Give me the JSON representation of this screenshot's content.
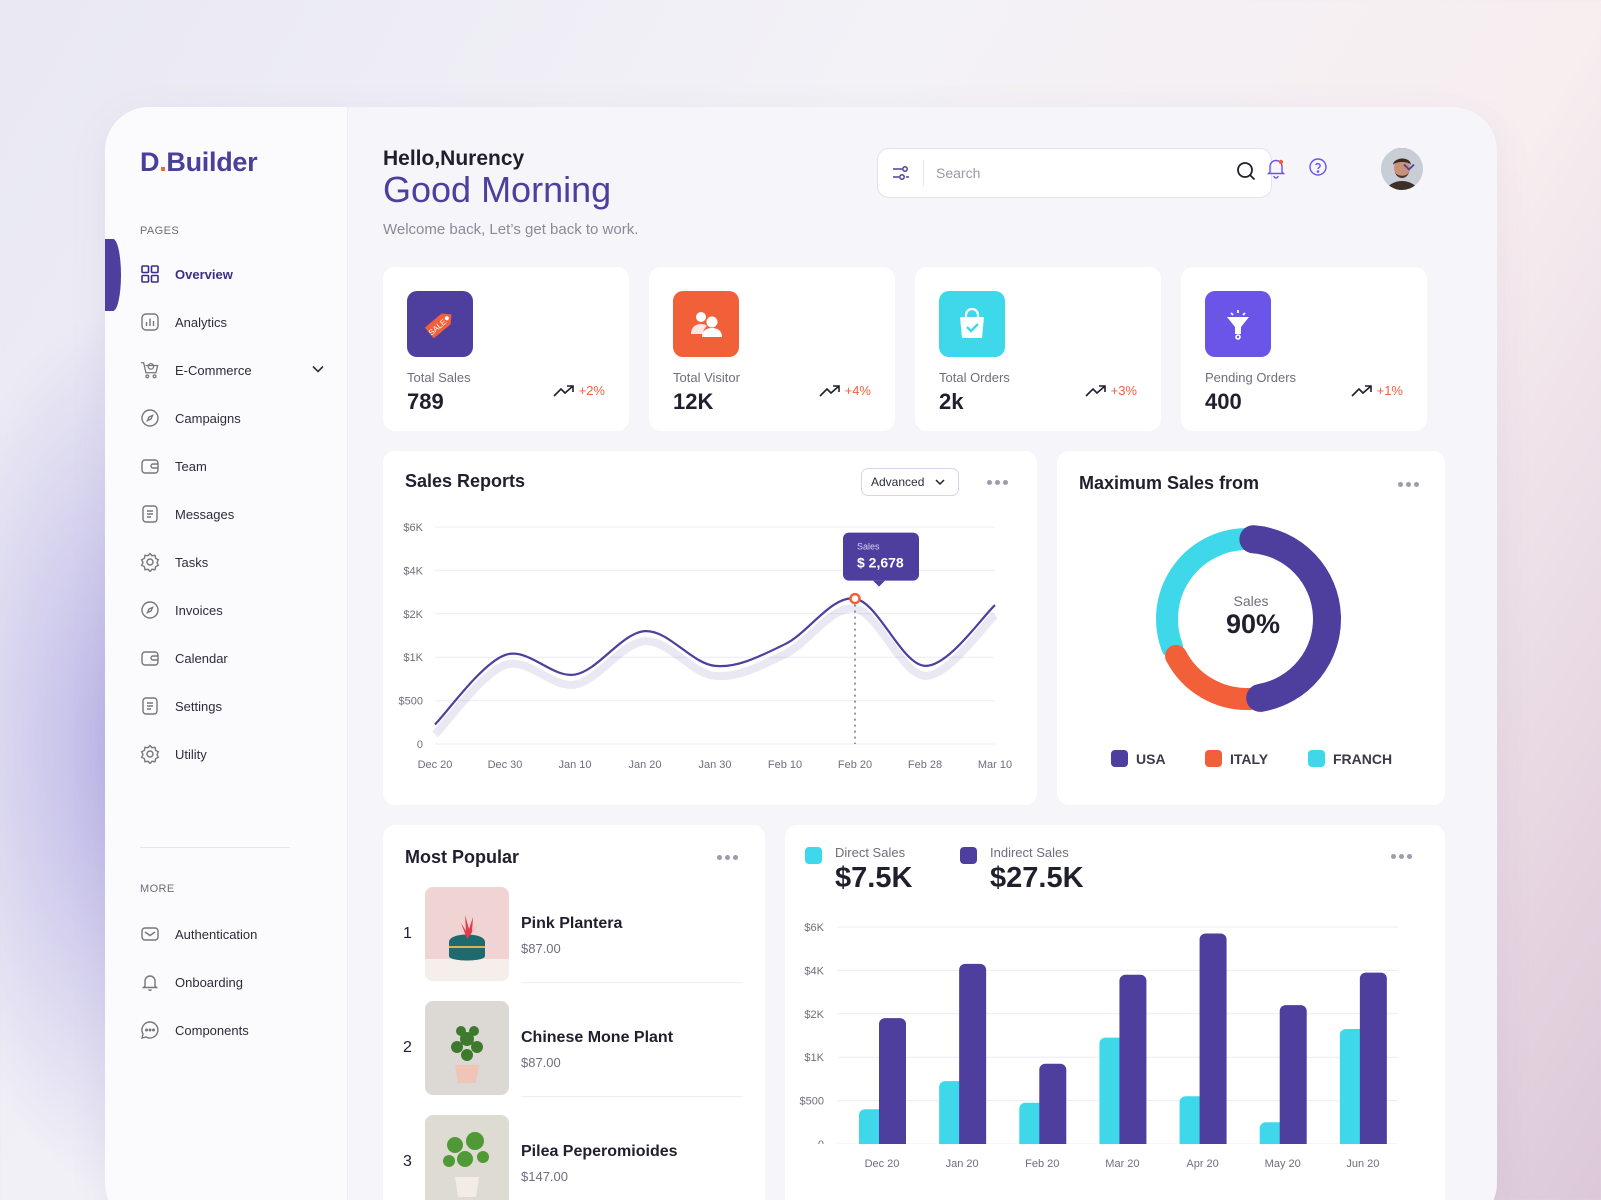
{
  "app": {
    "logo_main": "D",
    "logo_dot": ".",
    "logo_rest": "Builder"
  },
  "sidebar": {
    "pages_label": "PAGES",
    "items": [
      {
        "label": "Overview",
        "icon": "grid-icon",
        "active": true
      },
      {
        "label": "Analytics",
        "icon": "analytics-icon"
      },
      {
        "label": "E-Commerce",
        "icon": "cart-icon"
      },
      {
        "label": "Campaigns",
        "icon": "compass-icon"
      },
      {
        "label": "Team",
        "icon": "wallet-icon"
      },
      {
        "label": "Messages",
        "icon": "document-icon"
      },
      {
        "label": "Tasks",
        "icon": "gear-icon"
      },
      {
        "label": "Invoices",
        "icon": "compass-icon"
      },
      {
        "label": "Calendar",
        "icon": "wallet-icon"
      },
      {
        "label": "Settings",
        "icon": "document-icon"
      },
      {
        "label": "Utility",
        "icon": "gear-icon"
      }
    ],
    "more_label": "MORE",
    "more_items": [
      {
        "label": "Authentication",
        "icon": "mail-icon"
      },
      {
        "label": "Onboarding",
        "icon": "bell-icon"
      },
      {
        "label": "Components",
        "icon": "chat-icon"
      }
    ]
  },
  "header": {
    "hello": "Hello,Nurency",
    "greeting": "Good Morning",
    "subtitle": "Welcome back, Let’s get back to work.",
    "search_placeholder": "Search"
  },
  "stats": [
    {
      "label": "Total Sales",
      "value": "789",
      "trend": "+2%",
      "color": "#4e3e9e",
      "icon": "sale-tag-icon"
    },
    {
      "label": "Total Visitor",
      "value": "12K",
      "trend": "+4%",
      "color": "#f2603a",
      "icon": "users-icon"
    },
    {
      "label": "Total Orders",
      "value": "2k",
      "trend": "+3%",
      "color": "#3fd8ea",
      "icon": "shopping-bag-icon"
    },
    {
      "label": "Pending Orders",
      "value": "400",
      "trend": "+1%",
      "color": "#6a55e8",
      "icon": "funnel-icon"
    }
  ],
  "sales_report": {
    "title": "Sales Reports",
    "filter": "Advanced",
    "tooltip_label": "Sales",
    "tooltip_value": "$ 2,678"
  },
  "max_sales": {
    "title": "Maximum Sales from",
    "center_label": "Sales",
    "center_value": "90%",
    "legend": [
      {
        "label": "USA",
        "color": "#4e3e9e"
      },
      {
        "label": "ITALY",
        "color": "#f2603a"
      },
      {
        "label": "FRANCH",
        "color": "#3fd8ea"
      }
    ]
  },
  "most_popular": {
    "title": "Most Popular",
    "items": [
      {
        "rank": "1",
        "name": "Pink Plantera",
        "price": "$87.00"
      },
      {
        "rank": "2",
        "name": "Chinese Mone Plant",
        "price": "$87.00"
      },
      {
        "rank": "3",
        "name": "Pilea Peperomioides",
        "price": "$147.00"
      }
    ]
  },
  "bars_card": {
    "direct_label": "Direct Sales",
    "direct_value": "$7.5K",
    "indirect_label": "Indirect Sales",
    "indirect_value": "$27.5K"
  },
  "chart_data": [
    {
      "type": "line",
      "x": [
        "Dec 20",
        "Dec 30",
        "Jan 10",
        "Jan 20",
        "Jan 30",
        "Feb 10",
        "Feb 20",
        "Feb 28",
        "Mar 10"
      ],
      "y_ticks": [
        "0",
        "$500",
        "$1K",
        "$2K",
        "$4K",
        "$6K"
      ],
      "values": [
        0.45,
        2.05,
        1.6,
        2.6,
        1.8,
        2.3,
        3.35,
        1.8,
        3.2
      ],
      "highlight": {
        "x": "Feb 20",
        "value": "$ 2,678"
      },
      "color": "#4e3e9e"
    },
    {
      "type": "pie",
      "labels": [
        "USA",
        "ITALY",
        "FRANCH"
      ],
      "values": [
        48,
        20,
        32
      ],
      "colors": [
        "#4e3e9e",
        "#f2603a",
        "#3fd8ea"
      ]
    },
    {
      "type": "bar",
      "categories": [
        "Dec 20",
        "Jan 20",
        "Feb 20",
        "Mar 20",
        "Apr 20",
        "May 20",
        "Jun 20"
      ],
      "y_ticks": [
        "0",
        "$500",
        "$1K",
        "$2K",
        "$4K",
        "$6K"
      ],
      "series": [
        {
          "name": "Direct Sales",
          "color": "#3fd8ea",
          "values": [
            0.8,
            1.45,
            0.95,
            2.45,
            1.1,
            0.5,
            2.65
          ]
        },
        {
          "name": "Indirect Sales",
          "color": "#4e3e9e",
          "values": [
            2.9,
            4.15,
            1.85,
            3.9,
            4.85,
            3.2,
            3.95
          ]
        }
      ]
    }
  ]
}
